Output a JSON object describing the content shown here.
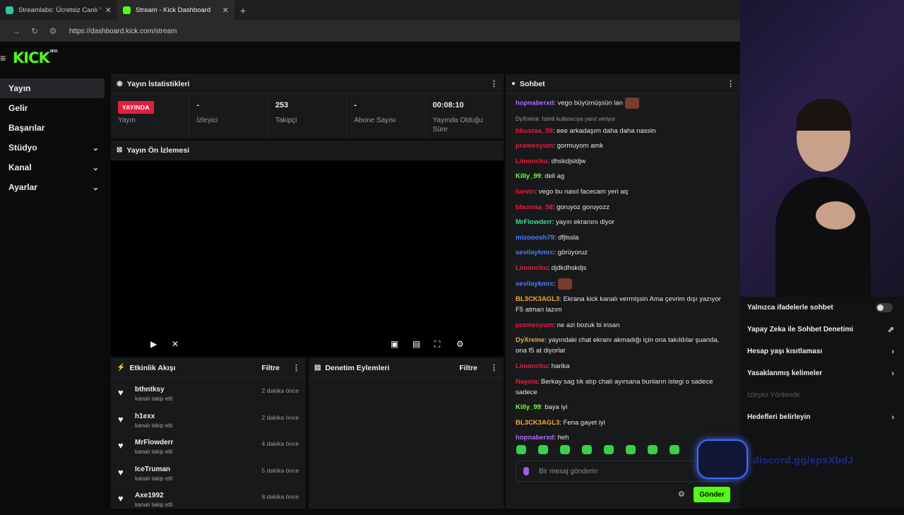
{
  "browser": {
    "tabs": [
      {
        "title": "Streamlabs: Ücretsiz Canlı Yayın",
        "fav_color": "#31c3a2"
      },
      {
        "title": "Stream - Kick Dashboard",
        "fav_color": "#53fc18"
      }
    ],
    "url": "https://dashboard.kick.com/stream"
  },
  "brand": {
    "logo": "KICK",
    "beta": "BETA"
  },
  "sidebar": {
    "items": [
      {
        "label": "Yayın"
      },
      {
        "label": "Gelir"
      },
      {
        "label": "Başarılar"
      },
      {
        "label": "Stüdyo"
      },
      {
        "label": "Kanal"
      },
      {
        "label": "Ayarlar"
      }
    ]
  },
  "stats": {
    "title": "Yayın İstatistikleri",
    "live_badge": "YAYINDA",
    "items": [
      {
        "value": "",
        "label": "Yayın"
      },
      {
        "value": "-",
        "label": "İzleyici"
      },
      {
        "value": "253",
        "label": "Takipçi"
      },
      {
        "value": "-",
        "label": "Abone Sayısı"
      },
      {
        "value": "00:08:10",
        "label": "Yayında Olduğu Süre"
      }
    ]
  },
  "preview": {
    "title": "Yayın Ön İzlemesi"
  },
  "activity": {
    "title": "Etkinlik Akışı",
    "filter": "Filtre",
    "items": [
      {
        "name": "bthntksy",
        "sub": "kanalı takip etti",
        "time": "2 dakika önce"
      },
      {
        "name": "h1exx",
        "sub": "kanalı takip etti",
        "time": "2 dakika önce"
      },
      {
        "name": "MrFlowderr",
        "sub": "kanalı takip etti",
        "time": "4 dakika önce"
      },
      {
        "name": "IceTruman",
        "sub": "kanalı takip etti",
        "time": "5 dakika önce"
      },
      {
        "name": "Axe1992",
        "sub": "kanalı takip etti",
        "time": "8 dakika önce"
      }
    ]
  },
  "moderation": {
    "title": "Denetim Eylemleri",
    "filter": "Filtre"
  },
  "chat": {
    "title": "Sohbet",
    "messages": [
      {
        "user": "hopnaberxd",
        "color": "#a970ff",
        "text": ": vego büyümüşsün lan",
        "emote": true
      },
      {
        "user": "bbusraa_58",
        "color": "#e0213e",
        "text": ": eee arkadaşım daha daha nassin",
        "reply": "DyXreine:  İsimli kullanıcıya yanıt veriyor"
      },
      {
        "user": "pramesyum",
        "color": "#e0213e",
        "text": ": gormuyom amk"
      },
      {
        "user": "Limonchu",
        "color": "#e0213e",
        "text": ": dhskdjsldjw"
      },
      {
        "user": "Killy_99",
        "color": "#7cfc3a",
        "text": ": deli ag"
      },
      {
        "user": "iuevin",
        "color": "#e0213e",
        "text": ": vego bu nasıl facecam yeri aq"
      },
      {
        "user": "bbusraa_58",
        "color": "#e0213e",
        "text": ": goruyoz goruyozz"
      },
      {
        "user": "MrFlowderr",
        "color": "#3ddc97",
        "text": ": yayın ekranını diyor"
      },
      {
        "user": "mizooosh79",
        "color": "#4a7dff",
        "text": ": dfjlssla"
      },
      {
        "user": "sevilaykmrc",
        "color": "#4a7dff",
        "text": ": görüyoruz"
      },
      {
        "user": "Limonchu",
        "color": "#e0213e",
        "text": ": djdkdhskdjs"
      },
      {
        "user": "sevilaykmrc",
        "color": "#4a7dff",
        "text": ":",
        "emote": true
      },
      {
        "user": "BL3CK3AGL3",
        "color": "#f2a93b",
        "text": ": Ekrana kick kanalı vermişsin Ama çevrim dışı yazıyor F5 atman lazım"
      },
      {
        "user": "pramesyum",
        "color": "#e0213e",
        "text": ": ne azi bozuk bi insan"
      },
      {
        "user": "DyXreine",
        "color": "#f2a93b",
        "text": ": yayındaki chat ekranı akmadığı için ona takıldılar şuanda, ona f5 at diyorlar"
      },
      {
        "user": "Limonchu",
        "color": "#e0213e",
        "text": ": harika"
      },
      {
        "user": "Naysia",
        "color": "#e0213e",
        "text": ": Berkay sag tık atıp chati ayırsana bunların istegi o sadece sadece"
      },
      {
        "user": "Killy_99",
        "color": "#7cfc3a",
        "text": ": baya iyi"
      },
      {
        "user": "BL3CK3AGL3",
        "color": "#f2a93b",
        "text": ": Fena gayet iyi"
      },
      {
        "user": "hopnaberxd",
        "color": "#a970ff",
        "text": ": heh"
      }
    ],
    "input_placeholder": "Bir mesaj gönderin",
    "send_label": "Gönder"
  },
  "chat_settings": {
    "items": [
      {
        "label": "Yalnızca ifadelerle sohbet",
        "kind": "toggle"
      },
      {
        "label": "Yapay Zeka ile Sohbet Denetimi",
        "kind": "external"
      },
      {
        "label": "Hesap yaşı kısıtlaması",
        "kind": "chevron"
      },
      {
        "label": "Yasaklanmış kelimeler",
        "kind": "chevron"
      },
      {
        "label": "İzleyici Yönlendir",
        "kind": "disabled"
      },
      {
        "label": "Hedefleri belirleyin",
        "kind": "chevron"
      }
    ]
  },
  "overlay": {
    "discord_text": "discord.gg/epsXbdJ"
  },
  "colors": {
    "accent": "#53fc18",
    "live": "#e0213e"
  }
}
